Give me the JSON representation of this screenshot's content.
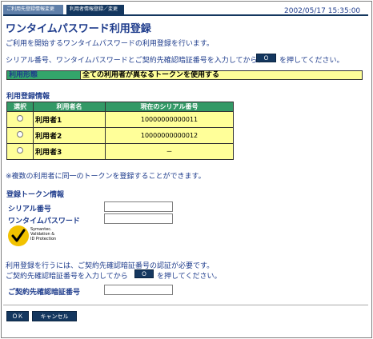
{
  "header": {
    "tab_primary": "ご利用先登録情報変更",
    "tab_secondary": "利用者情報登録／変更",
    "datetime": "2002/05/17 15:35:00"
  },
  "page_title": "ワンタイムパスワード利用登録",
  "intro": {
    "line1": "ご利用を開始するワンタイムパスワードの利用登録を行います。",
    "line2_before": "シリアル番号、ワンタイムパスワードとご契約先確認暗証番号を入力してから、",
    "line2_after": "を押してください。",
    "ok_label": "ＯＫ"
  },
  "usage_mode": {
    "label": "利用形態",
    "value": "全ての利用者が異なるトークンを使用する"
  },
  "registration_info": {
    "title": "利用登録情報",
    "columns": [
      "選択",
      "利用者名",
      "現在のシリアル番号"
    ],
    "rows": [
      {
        "name": "利用者1",
        "serial": "10000000000011"
      },
      {
        "name": "利用者2",
        "serial": "10000000000012"
      },
      {
        "name": "利用者3",
        "serial": "－"
      }
    ],
    "note": "※複数の利用者に同一のトークンを登録することができます。"
  },
  "token_info": {
    "title": "登録トークン情報",
    "serial_label": "シリアル番号",
    "otp_label": "ワンタイムパスワード",
    "serial_value": "",
    "otp_value": ""
  },
  "logo": {
    "line1": "Symantec.",
    "line2": "Validation &",
    "line3": "ID Protection"
  },
  "auth": {
    "line1": "利用登録を行うには、ご契約先確認暗証番号の認証が必要です。",
    "line2_before": "ご契約先確認暗証番号を入力してから",
    "line2_after": "を押してください。",
    "ok_label": "ＯＫ",
    "pin_label": "ご契約先確認暗証番号",
    "pin_value": ""
  },
  "footer": {
    "ok_label": "ＯＫ",
    "cancel_label": "キャンセル"
  },
  "colors": {
    "navy": "#14375f",
    "title_blue": "#1e3c8c",
    "table_header_green": "#339966",
    "table_cell_yellow": "#ffff99"
  }
}
